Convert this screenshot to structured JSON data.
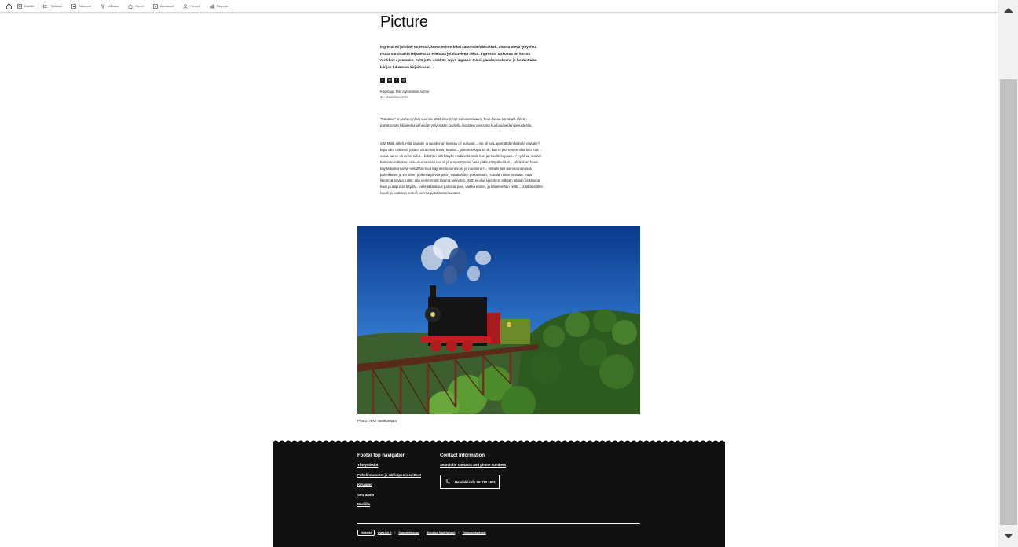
{
  "toolbar": {
    "items": [
      {
        "label": "Sisältö",
        "icon": "content-icon"
      },
      {
        "label": "Työkalut",
        "icon": "tools-icon"
      },
      {
        "label": "Rakenne",
        "icon": "structure-icon"
      },
      {
        "label": "Ulkoasu",
        "icon": "appearance-icon"
      },
      {
        "label": "Kieret",
        "icon": "extend-icon"
      },
      {
        "label": "Asetukset",
        "icon": "config-icon"
      },
      {
        "label": "People",
        "icon": "people-icon"
      },
      {
        "label": "Reports",
        "icon": "reports-icon"
      }
    ]
  },
  "article": {
    "title": "Test Automation: Text And Picture",
    "lead": "Ingressi eli johdate on teksti, kuten esimerkiksi sanomalehtiartikkeli, alussa oleva lyhyehkö mutta varsinaista leipätekstiä edeltävä johdattelева teksti. Ingressin tarkoitus on kertoa otsikkoa syvemmin, mitä juttu sisältää. Hyvä ingressi toimii yleiskuvauksena ja houkuttelee lukijan lukemaan kirjoituksen.",
    "author": "Kirjoittaja: Test Automation Author",
    "date": "31. Maaliskuu 2021",
    "paragraph1": "\"Rautatie\" on Juhani Ahon vuonna 1884 ilmestynyt esikoisromaani. Teos kuvaa karvaspä elävän pariskunnan hiljaiseloa ja heidän yrityksiään kuvitella rautatien olemusta kuulopuheiden perusteella.",
    "paragraph2": "Sitä Matti aitteli, mitä rautatie ja ruustinnan kanssa oli puhunut... Vai oli se Lappmähden kirkolla rautatie? Eipä ollut uskonut, joka ei ollut omin korvin kuullut... ja kummoopa se oli, kun ei pitä ennen ollut kuu tuut... vasta kai se oli sinne tullut... Eikähän sitä härylle endä vetä mitä, kun ja maalle kopusa...? Kyllä se mahtai kumman näköinen olla—kummahan tuo oli ja ennesttömmin vetä pitkin siltäpitkesään... olisikohan hänä käydä katsomassa-vielähän muut käyneet kuin navoist ja ruustinna?... Viittaile tieli nieman nenässä puheikkeen ja vei sitten polkesta järveä pitkin Taivalahden poikukkaan, Huttulan talon rantaan. Kuta likemmä maata tuittin, sitä verkemmäti tamma nytkytteli. Matti ei ollut kiirehtinyt pitkään aikaan, ja tamma kuuli ja aapunsa käydä... vielä takaakuun juoksua pani, vaikka eutset, ja kävelemään heitti... ja takaosetkin käveli ja loutanen kohoili kuin helpotuksesta huoaten.",
    "image_caption": "Photo: Testi Valokuvaaja"
  },
  "footer": {
    "nav_heading": "Footer top navigation",
    "nav_links": [
      "Yhteystiedot",
      "Puhelinnumerot ja sähköpostiosoitteet",
      "Kirjaamo",
      "Seuraamo",
      "Mediille"
    ],
    "contact_heading": "Contact information",
    "contact_link": "Search for contacts and phone numbers",
    "helsinki_button": "Helsinki-info 09 310 1691",
    "logo_text": "Helsinki",
    "bottom_links": [
      "www.hel.fi",
      "Saavutettavuus",
      "Sivuston käyttöehdot",
      "Tietosuojaseloste"
    ]
  },
  "colors": {
    "footer_bg": "#111111",
    "toolbar_bg": "#ffffff",
    "scrollbar_thumb": "#c1c1c1"
  }
}
